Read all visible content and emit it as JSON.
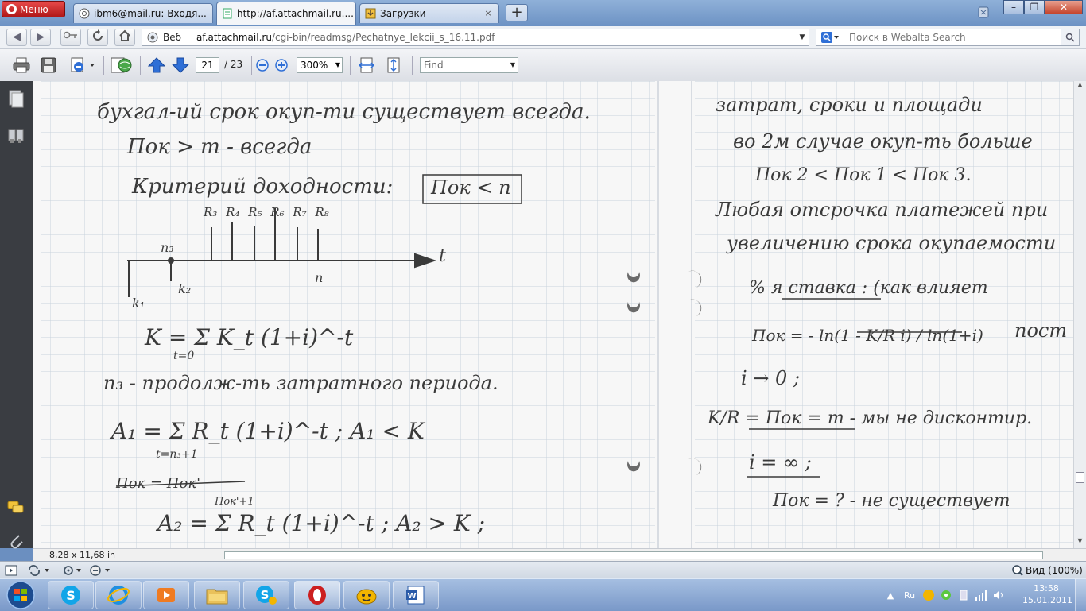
{
  "browser": {
    "menu_label": "Меню",
    "tabs": [
      {
        "title": "ibm6@mail.ru: Входя...",
        "active": false
      },
      {
        "title": "http://af.attachmail.ru....",
        "active": true
      },
      {
        "title": "Загрузки",
        "active": false
      }
    ],
    "new_tab_label": "+",
    "close_label": "×"
  },
  "address": {
    "prefix": "Веб",
    "domain": "af.attachmail.ru",
    "path": "/cgi-bin/readmsg/Pechatnye_lekcii_s_16.11.pdf",
    "search_placeholder": "Поиск в Webalta Search"
  },
  "pdf_toolbar": {
    "current_page": "21",
    "total_pages": "/ 23",
    "zoom": "300%",
    "find_placeholder": "Find"
  },
  "document": {
    "page_size": "8,28 x 11,68 in",
    "left_lines": [
      "бухгал-ий срок окуп-ти существует всегда.",
      "Пок > m - всегда",
      "Критерий доходности:",
      "Пок < n",
      "n₃",
      "R₃  R₄  R₅  R₆  R₇  R₈",
      "t",
      "k₁",
      "k₂",
      "n",
      "K = Σ K_t (1+i)^-t",
      "t=0",
      "n₃ - продолж-ть затратного периода.",
      "A₁ = Σ R_t (1+i)^-t ;    A₁ < K",
      "t=n₃+1",
      "Пок = Пок'",
      "A₂ = Σ R_t (1+i)^-t ;   A₂ > K ;",
      "Пок'+1"
    ],
    "right_lines": [
      "затрат, сроки и площади",
      "во 2м случае окуп-ть больше",
      "Пок 2 < Пок 1 < Пок 3.",
      "Любая отсрочка платежей при",
      "увеличению срока окупаемости",
      "% я ставка : (как влияет",
      "Пок = - ln(1 - K/R i) / ln(1+i)",
      "пост",
      "i → 0 ;",
      "K/R = Пок = m   - мы не дисконтир.",
      "i = ∞ ;",
      "Пок = ? - не существует"
    ]
  },
  "status": {
    "view_label": "Вид (100%)"
  },
  "taskbar": {
    "apps": [
      "Skype",
      "Internet Explorer",
      "Media Player",
      "Explorer",
      "Skype Tools",
      "Opera",
      "Mail.Ru Agent",
      "Word"
    ],
    "lang": "Ru",
    "time": "13:58",
    "date": "15.01.2011"
  },
  "colors": {
    "opera_red": "#cc1f1f",
    "toolbar_blue": "#2f6fd6",
    "ink": "#3a3a3a",
    "grid": "#c9d3dc"
  }
}
